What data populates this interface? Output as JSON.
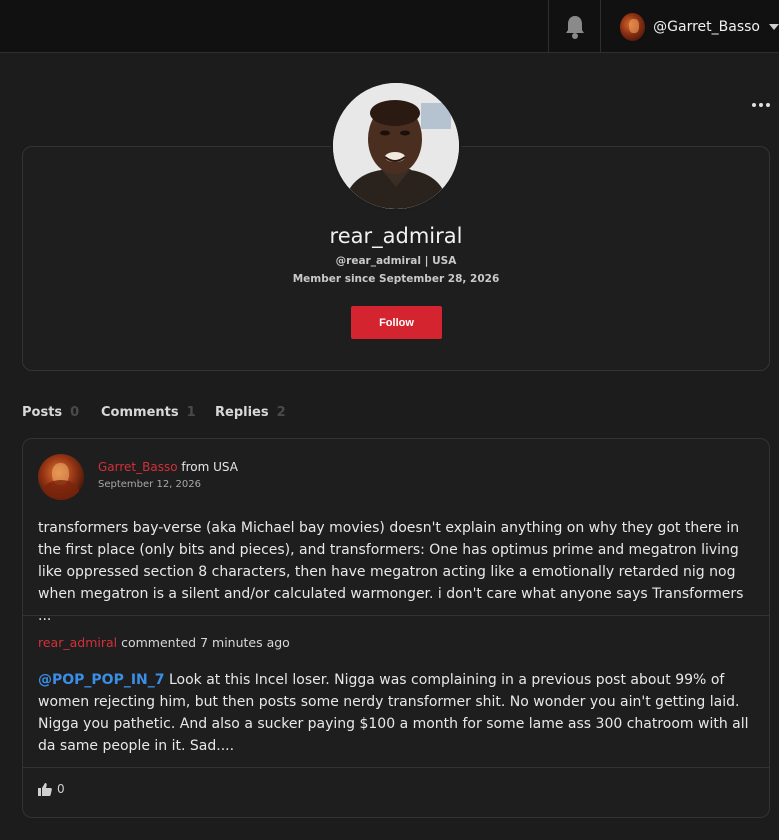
{
  "topbar": {
    "username": "@Garret_Basso"
  },
  "profile": {
    "display_name": "rear_admiral",
    "handle_location": "@rear_admiral | USA",
    "member_since": "Member since September 28, 2026",
    "follow_label": "Follow"
  },
  "tabs": [
    {
      "label": "Posts",
      "count": "0"
    },
    {
      "label": "Comments",
      "count": "1"
    },
    {
      "label": "Replies",
      "count": "2"
    }
  ],
  "post": {
    "author": "Garret_Basso",
    "from_text": "from USA",
    "date": "September 12, 2026",
    "body": "transformers bay-verse (aka Michael bay movies) doesn't explain anything on why they got there in the first place (only bits and pieces), and transformers: One has optimus prime and megatron living like oppressed section 8 characters, then have megatron acting like a emotionally retarded nig nog when megatron is a silent and/or calculated warmonger. i don't care what anyone says Transformers ..."
  },
  "comment": {
    "author": "rear_admiral",
    "meta": "commented 7 minutes ago",
    "mention": "@POP_POP_IN_7",
    "body": "Look at this Incel loser. Nigga was complaining in a previous post about 99% of women rejecting him, but then posts some nerdy transformer shit. No wonder you ain't getting laid. Nigga you pathetic. And also a sucker paying $100 a month for some lame ass 300 chatroom with all da same people in it. Sad....",
    "likes": "0"
  },
  "colors": {
    "accent_red": "#d3242f",
    "mention_blue": "#3a8ee6",
    "background": "#1c1c1c"
  },
  "icons": [
    "bell-icon",
    "chevron-down-icon",
    "more-dots-icon",
    "thumbs-up-icon"
  ]
}
